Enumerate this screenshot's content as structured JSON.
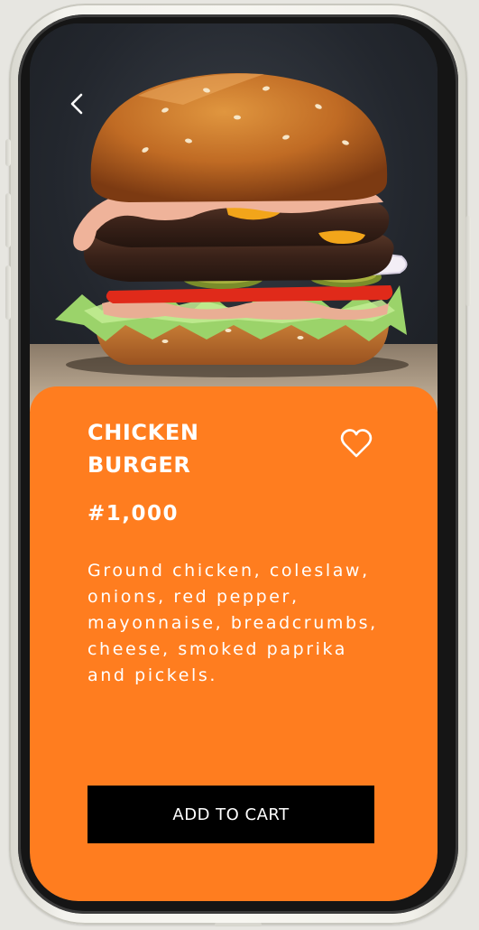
{
  "product": {
    "title_line1": "CHICKEN",
    "title_line2": "BURGER",
    "price": "#1,000",
    "description": "Ground chicken, coleslaw, onions, red pepper, mayonnaise, breadcrumbs, cheese, smoked paprika and pickels."
  },
  "actions": {
    "add_to_cart_label": "ADD TO CART"
  },
  "icons": {
    "back": "back-chevron-icon",
    "favorite": "heart-outline-icon"
  },
  "colors": {
    "accent": "#ff7d1f",
    "button": "#000000",
    "text": "#ffffff"
  }
}
